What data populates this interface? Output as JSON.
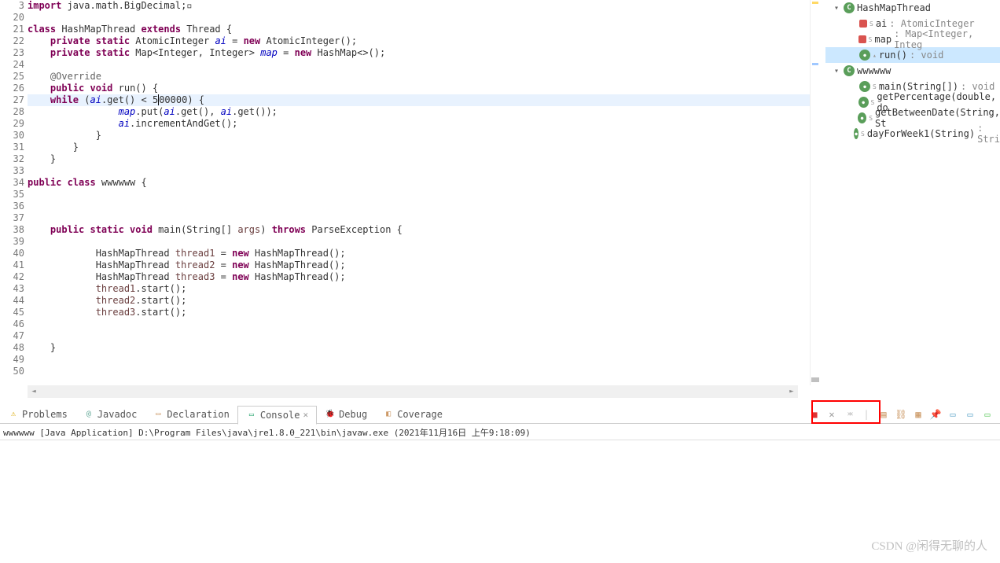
{
  "code": {
    "lines": [
      {
        "n": 3,
        "fold": "+",
        "html": "<span class='kw'>import</span> java.math.BigDecimal;▫"
      },
      {
        "n": 20,
        "html": ""
      },
      {
        "n": 21,
        "html": "<span class='kw'>class</span> HashMapThread <span class='kw'>extends</span> Thread {"
      },
      {
        "n": 22,
        "html": "    <span class='kw'>private static</span> AtomicInteger <span class='fld'>ai</span> = <span class='kw'>new</span> AtomicInteger();"
      },
      {
        "n": 23,
        "html": "    <span class='kw'>private static</span> Map&lt;Integer, Integer&gt; <span class='fld'>map</span> = <span class='kw'>new</span> HashMap&lt;&gt;();"
      },
      {
        "n": 24,
        "html": ""
      },
      {
        "n": 25,
        "fold": "-",
        "html": "    <span class='ann'>@Override</span>"
      },
      {
        "n": 26,
        "html": "    <span class='kw'>public void</span> run() {"
      },
      {
        "n": 27,
        "hl": true,
        "html": "    <span class='kw'>while</span> (<span class='fld'>ai</span>.get() &lt; 5<span style='border-left:1px solid #000'>0</span>0000) {"
      },
      {
        "n": 28,
        "html": "                <span class='fld'>map</span>.put(<span class='fld'>ai</span>.get(), <span class='fld'>ai</span>.get());"
      },
      {
        "n": 29,
        "html": "                <span class='fld'>ai</span>.incrementAndGet();"
      },
      {
        "n": 30,
        "html": "            }"
      },
      {
        "n": 31,
        "html": "        }"
      },
      {
        "n": 32,
        "html": "    }"
      },
      {
        "n": 33,
        "html": ""
      },
      {
        "n": 34,
        "html": "<span class='kw'>public class</span> wwwwww {"
      },
      {
        "n": 35,
        "html": ""
      },
      {
        "n": 36,
        "html": ""
      },
      {
        "n": 37,
        "html": ""
      },
      {
        "n": 38,
        "fold": "-",
        "html": "    <span class='kw'>public static void</span> main(String[] <span class='var'>args</span>) <span class='kw'>throws</span> ParseException {"
      },
      {
        "n": 39,
        "html": ""
      },
      {
        "n": 40,
        "html": "            HashMapThread <span class='var'>thread1</span> = <span class='kw'>new</span> HashMapThread();"
      },
      {
        "n": 41,
        "html": "            HashMapThread <span class='var'>thread2</span> = <span class='kw'>new</span> HashMapThread();"
      },
      {
        "n": 42,
        "html": "            HashMapThread <span class='var'>thread3</span> = <span class='kw'>new</span> HashMapThread();"
      },
      {
        "n": 43,
        "html": "            <span class='var'>thread1</span>.start();"
      },
      {
        "n": 44,
        "html": "            <span class='var'>thread2</span>.start();"
      },
      {
        "n": 45,
        "html": "            <span class='var'>thread3</span>.start();"
      },
      {
        "n": 46,
        "html": ""
      },
      {
        "n": 47,
        "html": ""
      },
      {
        "n": 48,
        "html": "    }"
      },
      {
        "n": 49,
        "html": ""
      },
      {
        "n": 50,
        "html": ""
      }
    ]
  },
  "outline": {
    "items": [
      {
        "indent": 0,
        "expander": "▾",
        "icon": "class",
        "name": "HashMapThread",
        "type": ""
      },
      {
        "indent": 1,
        "expander": "",
        "icon": "priv",
        "badge": "S",
        "name": "ai",
        "type": " : AtomicInteger"
      },
      {
        "indent": 1,
        "expander": "",
        "icon": "priv",
        "badge": "S",
        "name": "map",
        "type": " : Map<Integer, Integ"
      },
      {
        "indent": 1,
        "expander": "",
        "icon": "pub",
        "badge": "▴",
        "name": "run()",
        "type": " : void",
        "sel": true
      },
      {
        "indent": 0,
        "expander": "▾",
        "icon": "class",
        "name": "wwwwww",
        "type": ""
      },
      {
        "indent": 1,
        "expander": "",
        "icon": "pub",
        "badge": "S",
        "name": "main(String[])",
        "type": " : void"
      },
      {
        "indent": 1,
        "expander": "",
        "icon": "pub",
        "badge": "S",
        "name": "getPercentage(double, do",
        "type": ""
      },
      {
        "indent": 1,
        "expander": "",
        "icon": "pub",
        "badge": "S",
        "name": "getBetweenDate(String, St",
        "type": ""
      },
      {
        "indent": 1,
        "expander": "",
        "icon": "pub",
        "badge": "S",
        "name": "dayForWeek1(String)",
        "type": " : Stri"
      }
    ]
  },
  "tabs": {
    "items": [
      {
        "icon": "⚠",
        "color": "#d9a800",
        "label": "Problems"
      },
      {
        "icon": "@",
        "color": "#6a9",
        "label": "Javadoc"
      },
      {
        "icon": "▭",
        "color": "#c96",
        "label": "Declaration"
      },
      {
        "icon": "▭",
        "color": "#3a7",
        "label": "Console",
        "active": true,
        "closable": true
      },
      {
        "icon": "🐞",
        "color": "#8a8",
        "label": "Debug"
      },
      {
        "icon": "◧",
        "color": "#c96",
        "label": "Coverage"
      }
    ]
  },
  "toolbar": {
    "items": [
      {
        "name": "terminate",
        "glyph": "■",
        "color": "#d33"
      },
      {
        "name": "remove-launch",
        "glyph": "✕",
        "color": "#999"
      },
      {
        "name": "remove-all",
        "glyph": "✕✕",
        "color": "#bbb"
      },
      {
        "name": "sep",
        "glyph": "|",
        "color": "#ccc"
      },
      {
        "name": "clear",
        "glyph": "▤",
        "color": "#c96"
      },
      {
        "name": "scroll-lock",
        "glyph": "⛓",
        "color": "#c96"
      },
      {
        "name": "word-wrap",
        "glyph": "▦",
        "color": "#c96"
      },
      {
        "name": "pin",
        "glyph": "📌",
        "color": "#6aa"
      },
      {
        "name": "display",
        "glyph": "▭",
        "color": "#6ac"
      },
      {
        "name": "open",
        "glyph": "▭",
        "color": "#6ac"
      },
      {
        "name": "new",
        "glyph": "▭",
        "color": "#6c6"
      }
    ]
  },
  "console_header": "wwwwww [Java Application] D:\\Program Files\\java\\jre1.8.0_221\\bin\\javaw.exe (2021年11月16日 上午9:18:09)",
  "watermark": "CSDN @闲得无聊的人"
}
